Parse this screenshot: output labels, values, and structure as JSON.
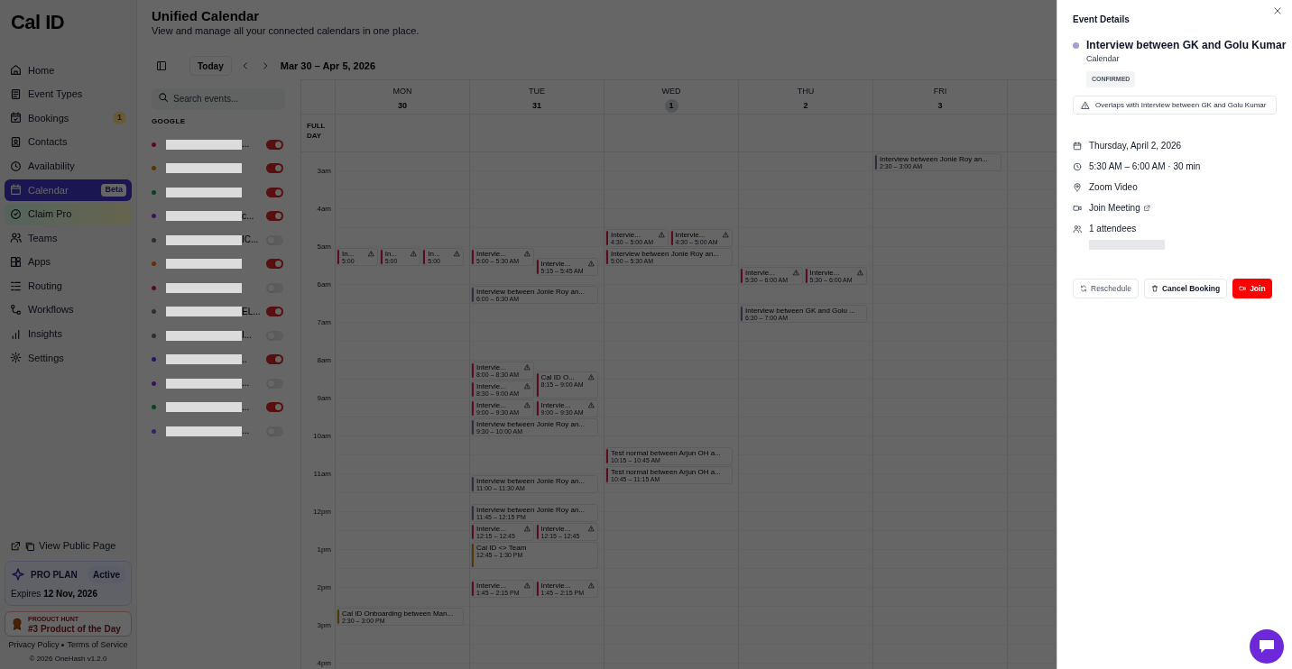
{
  "sidebar": {
    "logo": "Cal ID",
    "items": [
      {
        "label": "Home",
        "selected": false
      },
      {
        "label": "Event Types",
        "selected": false
      },
      {
        "label": "Bookings",
        "selected": false,
        "badge": "1"
      },
      {
        "label": "Contacts",
        "selected": false
      },
      {
        "label": "Availability",
        "selected": false
      },
      {
        "label": "Calendar",
        "selected": true,
        "badge": "Beta"
      },
      {
        "label": "Claim Pro",
        "selected": false
      },
      {
        "label": "Teams",
        "selected": false
      },
      {
        "label": "Apps",
        "selected": false
      },
      {
        "label": "Routing",
        "selected": false
      },
      {
        "label": "Workflows",
        "selected": false
      },
      {
        "label": "Insights",
        "selected": false
      },
      {
        "label": "Settings",
        "selected": false
      }
    ],
    "public_page": "View Public Page",
    "plan": {
      "name": "PRO PLAN",
      "status": "Active",
      "expires_label": "Expires",
      "expires": "12 Nov, 2026"
    },
    "product_hunt": {
      "kicker": "PRODUCT HUNT",
      "title": "#3 Product of the Day"
    },
    "links": [
      "Privacy Policy",
      "Terms of Service"
    ],
    "copyright": "© 2026 OneHash v1.2.0"
  },
  "header": {
    "title": "Unified Calendar",
    "subtitle": "View and manage all your connected calendars in one place."
  },
  "toolbar": {
    "today": "Today",
    "range": "Mar 30 – Apr 5, 2026"
  },
  "search": {
    "placeholder": "Search events..."
  },
  "calendars": {
    "group": "GOOGLE",
    "items": [
      {
        "color": "#5a0c1d",
        "on": true,
        "tail": "..."
      },
      {
        "color": "#513702",
        "on": true
      },
      {
        "color": "#09411e",
        "on": true
      },
      {
        "color": "#3b145e",
        "on": true,
        "tail": "c..."
      },
      {
        "color": "#2b2e33",
        "on": false,
        "tail": "IC..."
      },
      {
        "color": "#642e09",
        "on": true
      },
      {
        "color": "#5a0c1d",
        "on": false
      },
      {
        "color": "#2b2e33",
        "on": true,
        "tail": "EL..."
      },
      {
        "color": "#2b2e33",
        "on": false,
        "tail": "I..."
      },
      {
        "color": "#201c5c",
        "on": true,
        "tail": ".."
      },
      {
        "color": "#3b145e",
        "on": false,
        "tail": "..."
      },
      {
        "color": "#09411e",
        "on": true,
        "tail": "..."
      },
      {
        "color": "#282961",
        "on": false,
        "tail": "..."
      }
    ]
  },
  "week": {
    "full_day": "FULL DAY",
    "hours": [
      "3am",
      "4am",
      "5am",
      "6am",
      "7am",
      "8am",
      "9am",
      "10am",
      "11am",
      "12pm",
      "1pm",
      "2pm",
      "3pm",
      "4pm"
    ],
    "days": [
      {
        "name": "MON",
        "date": "30",
        "selected": false,
        "events": [
          {
            "kind": "third",
            "title": "In...",
            "time": "5:00",
            "color": "#5a0c1d",
            "conflict": true
          },
          {
            "kind": "third",
            "title": "In...",
            "time": "5:00",
            "color": "#5a0c1d",
            "conflict": true
          },
          {
            "kind": "third",
            "title": "In...",
            "time": "5:00",
            "color": "#5a0c1d",
            "conflict": true
          },
          {
            "kind": "full",
            "title": "Cal ID Onboarding between Man...",
            "time": "2:30 – 3:00 PM",
            "color": "#513702",
            "conflict": false
          }
        ]
      },
      {
        "name": "TUE",
        "date": "31",
        "selected": false,
        "events": [
          {
            "kind": "left",
            "title": "Intervie...",
            "time": "5:00 – 5:30 AM",
            "color": "#5a0c1d",
            "conflict": true
          },
          {
            "kind": "right",
            "title": "Intervie...",
            "time": "5:15 – 5:45 AM",
            "color": "#5a0c1d",
            "conflict": true
          },
          {
            "kind": "full",
            "title": "Interview between Jonie Roy an...",
            "time": "6:00 – 6:30 AM",
            "color": "#322c43",
            "conflict": false
          },
          {
            "kind": "left",
            "title": "Intervie...",
            "time": "8:00 – 8:30 AM",
            "color": "#5a0c1d",
            "conflict": true
          },
          {
            "kind": "right",
            "title": "Cal ID O...",
            "time": "8:15 – 9:00 AM",
            "color": "#5a0c1d",
            "conflict": true
          },
          {
            "kind": "left",
            "title": "Intervie...",
            "time": "8:30 – 9:00 AM",
            "color": "#5a0c1d",
            "conflict": true
          },
          {
            "kind": "left",
            "title": "Intervie...",
            "time": "9:00 – 9:30 AM",
            "color": "#5a0c1d",
            "conflict": true
          },
          {
            "kind": "right",
            "title": "Intervie...",
            "time": "9:00 – 9:30 AM",
            "color": "#5a0c1d",
            "conflict": true
          },
          {
            "kind": "full",
            "title": "Interview between Jonie Roy an...",
            "time": "9:30 – 10:00 AM",
            "color": "#322c43",
            "conflict": false
          },
          {
            "kind": "full",
            "title": "Interview between Jonie Roy an...",
            "time": "11:00 – 11:30 AM",
            "color": "#322c43",
            "conflict": false
          },
          {
            "kind": "full",
            "title": "Interview between Jonie Roy an...",
            "time": "11:45 – 12:15 PM",
            "color": "#322c43",
            "conflict": false
          },
          {
            "kind": "left",
            "title": "Intervie...",
            "time": "12:15 – 12:45",
            "color": "#5a0c1d",
            "conflict": true
          },
          {
            "kind": "right",
            "title": "Intervie...",
            "time": "12:15 – 12:45",
            "color": "#5a0c1d",
            "conflict": true
          },
          {
            "kind": "full",
            "title": "Cal ID <> Team",
            "time": "12:45 – 1:30 PM",
            "color": "#513702",
            "conflict": false
          },
          {
            "kind": "left",
            "title": "Intervie...",
            "time": "1:45 – 2:15 PM",
            "color": "#5a0c1d",
            "conflict": true
          },
          {
            "kind": "right",
            "title": "Intervie...",
            "time": "1:45 – 2:15 PM",
            "color": "#5a0c1d",
            "conflict": true
          }
        ]
      },
      {
        "name": "WED",
        "date": "1",
        "selected": true,
        "events": [
          {
            "kind": "left",
            "title": "Intervie...",
            "time": "4:30 – 5:00 AM",
            "color": "#5a0c1d",
            "conflict": true
          },
          {
            "kind": "right",
            "title": "Intervie...",
            "time": "4:30 – 5:00 AM",
            "color": "#5a0c1d",
            "conflict": true
          },
          {
            "kind": "full",
            "title": "Interview between Jonie Roy an...",
            "time": "5:00 – 5:30 AM",
            "color": "#5a0c1d",
            "conflict": false
          },
          {
            "kind": "full",
            "title": "Test normal between Arjun OH a...",
            "time": "10:15 – 10:45 AM",
            "color": "#5a0c1d",
            "conflict": false
          },
          {
            "kind": "full",
            "title": "Test normal between Arjun OH a...",
            "time": "10:45 – 11:15 AM",
            "color": "#5a0c1d",
            "conflict": false
          }
        ]
      },
      {
        "name": "THU",
        "date": "2",
        "selected": false,
        "events": [
          {
            "kind": "left",
            "title": "Intervie...",
            "time": "5:30 – 6:00 AM",
            "color": "#5a0c1d",
            "conflict": true
          },
          {
            "kind": "right",
            "title": "Intervie...",
            "time": "5:30 – 6:00 AM",
            "color": "#5a0c1d",
            "conflict": true
          },
          {
            "kind": "full",
            "title": "Interview between GK and Golu ...",
            "time": "6:30 – 7:00 AM",
            "color": "#322c43",
            "conflict": false
          }
        ]
      },
      {
        "name": "FRI",
        "date": "3",
        "selected": false,
        "events": [
          {
            "kind": "full",
            "title": "Interview between Jonie Roy an...",
            "time": "2:30 – 3:00 AM",
            "color": "#322c43",
            "conflict": false
          }
        ]
      }
    ]
  },
  "details": {
    "heading": "Event Details",
    "title": "Interview between GK and Golu Kumar",
    "color": "#a39fd0",
    "calendar": "Calendar",
    "status": "CONFIRMED",
    "warning": "Overlaps with Interview between GK and Golu Kumar",
    "rows": [
      {
        "kind": "text",
        "text": "Thursday, April 2, 2026"
      },
      {
        "kind": "text",
        "text": "5:30 AM – 6:00 AM · 30 min"
      },
      {
        "kind": "text",
        "text": "Zoom Video"
      },
      {
        "kind": "link",
        "text": "Join Meeting"
      },
      {
        "kind": "text",
        "text": "1 attendees"
      }
    ],
    "actions": [
      {
        "label": "Reschedule",
        "kind": "outline"
      },
      {
        "label": "Cancel Booking",
        "kind": "outline-strong"
      },
      {
        "label": "Join",
        "kind": "primary"
      }
    ]
  }
}
